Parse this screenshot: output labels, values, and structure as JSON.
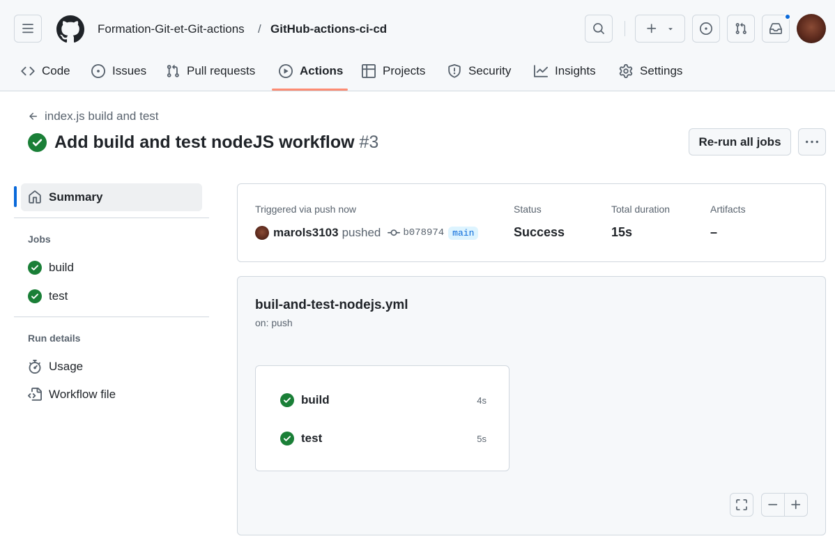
{
  "header": {
    "owner": "Formation-Git-et-Git-actions",
    "separator": "/",
    "repo": "GitHub-actions-ci-cd"
  },
  "tabs": [
    {
      "label": "Code",
      "icon": "code-icon"
    },
    {
      "label": "Issues",
      "icon": "issue-icon"
    },
    {
      "label": "Pull requests",
      "icon": "pull-request-icon"
    },
    {
      "label": "Actions",
      "icon": "play-icon",
      "active": true
    },
    {
      "label": "Projects",
      "icon": "table-icon"
    },
    {
      "label": "Security",
      "icon": "shield-icon"
    },
    {
      "label": "Insights",
      "icon": "graph-icon"
    },
    {
      "label": "Settings",
      "icon": "gear-icon"
    }
  ],
  "run": {
    "back_label": "index.js build and test",
    "title": "Add build and test nodeJS workflow",
    "number": "#3",
    "rerun_label": "Re-run all jobs"
  },
  "sidebar": {
    "summary_label": "Summary",
    "jobs_heading": "Jobs",
    "jobs": [
      "build",
      "test"
    ],
    "details_heading": "Run details",
    "usage_label": "Usage",
    "workflow_file_label": "Workflow file"
  },
  "summary": {
    "trigger_label": "Triggered via push now",
    "user": "marols3103",
    "action": "pushed",
    "commit": "b078974",
    "branch": "main",
    "status_label": "Status",
    "status_value": "Success",
    "duration_label": "Total duration",
    "duration_value": "15s",
    "artifacts_label": "Artifacts",
    "artifacts_value": "–"
  },
  "workflow": {
    "file": "buil-and-test-nodejs.yml",
    "trigger": "on: push",
    "jobs": [
      {
        "name": "build",
        "duration": "4s"
      },
      {
        "name": "test",
        "duration": "5s"
      }
    ]
  },
  "colors": {
    "success": "#1a7f37",
    "accent": "#0969da",
    "tab_underline": "#fd8c73"
  }
}
